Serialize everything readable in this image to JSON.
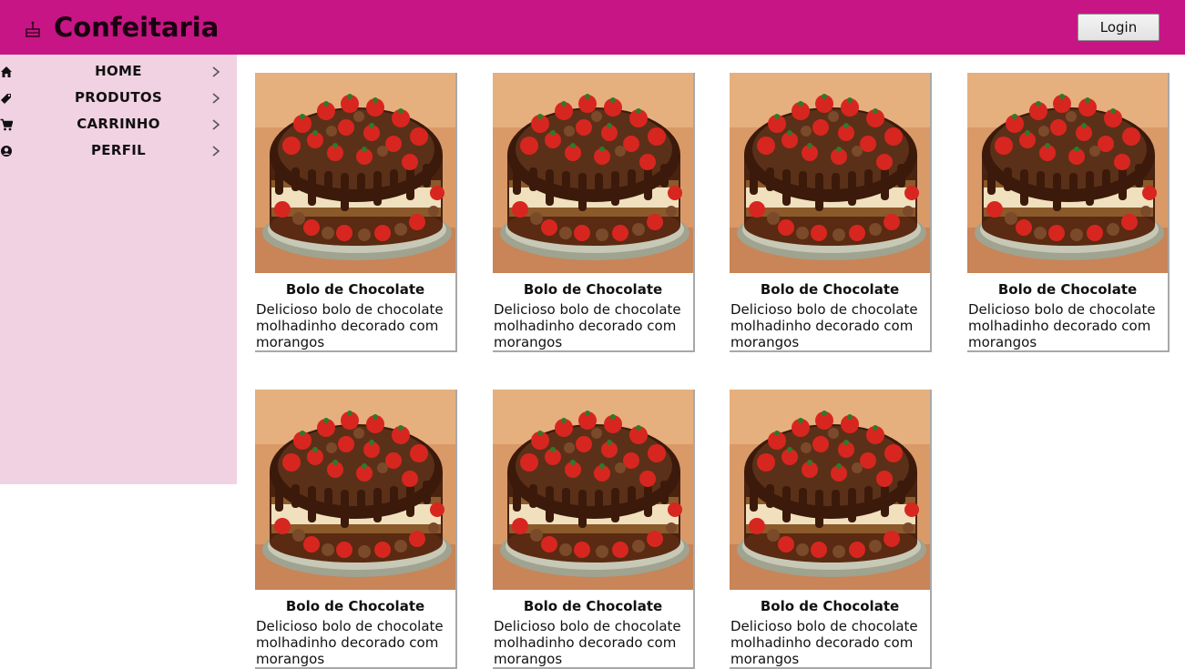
{
  "header": {
    "brand_icon": "cake-icon",
    "title": "Confeitaria",
    "login_label": "Login",
    "background_color": "#c71585"
  },
  "sidebar": {
    "background_color": "#f1d2e3",
    "items": [
      {
        "label": "HOME",
        "icon": "home-icon"
      },
      {
        "label": "PRODUTOS",
        "icon": "tag-icon"
      },
      {
        "label": "CARRINHO",
        "icon": "cart-icon"
      },
      {
        "label": "PERFIL",
        "icon": "user-icon"
      }
    ]
  },
  "products": [
    {
      "title": "Bolo de Chocolate",
      "description": "Delicioso bolo de chocolate molhadinho decorado com morangos"
    },
    {
      "title": "Bolo de Chocolate",
      "description": "Delicioso bolo de chocolate molhadinho decorado com morangos"
    },
    {
      "title": "Bolo de Chocolate",
      "description": "Delicioso bolo de chocolate molhadinho decorado com morangos"
    },
    {
      "title": "Bolo de Chocolate",
      "description": "Delicioso bolo de chocolate molhadinho decorado com morangos"
    },
    {
      "title": "Bolo de Chocolate",
      "description": "Delicioso bolo de chocolate molhadinho decorado com morangos"
    },
    {
      "title": "Bolo de Chocolate",
      "description": "Delicioso bolo de chocolate molhadinho decorado com morangos"
    },
    {
      "title": "Bolo de Chocolate",
      "description": "Delicioso bolo de chocolate molhadinho decorado com morangos"
    }
  ]
}
